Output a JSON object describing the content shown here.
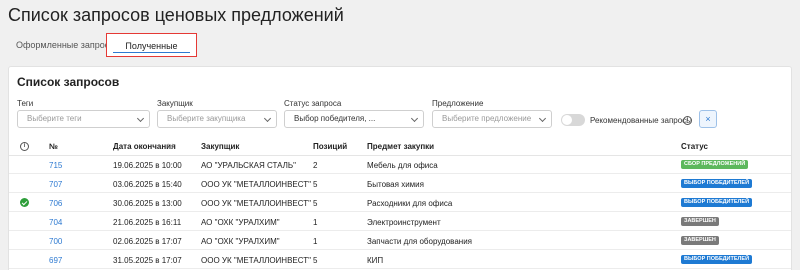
{
  "page": {
    "title": "Список запросов ценовых предложений"
  },
  "tabs": [
    {
      "label": "Оформленные запросы"
    },
    {
      "label": "Полученные запросы"
    }
  ],
  "card": {
    "title": "Список запросов"
  },
  "filters": {
    "tags": {
      "label": "Теги",
      "placeholder": "Выберите теги"
    },
    "buyer": {
      "label": "Закупщик",
      "placeholder": "Выберите закупщика"
    },
    "status": {
      "label": "Статус запроса",
      "value": "Выбор победителя, ..."
    },
    "offer": {
      "label": "Предложение",
      "placeholder": "Выберите предложение"
    },
    "recommended_label": "Рекомендованные запросы",
    "clear_symbol": "×"
  },
  "table": {
    "columns": [
      "№",
      "Дата окончания",
      "Закупщик",
      "Позиций",
      "Предмет закупки",
      "Статус"
    ],
    "rows": [
      {
        "num": "715",
        "date": "19.06.2025 в 10:00",
        "buyer": "АО \"УРАЛЬСКАЯ СТАЛЬ\"",
        "positions": "2",
        "subject": "Мебель для офиса",
        "status": "Сбор предложений",
        "status_color": "#5cb85c",
        "checked": false
      },
      {
        "num": "707",
        "date": "03.06.2025 в 15:40",
        "buyer": "ООО УК \"МЕТАЛЛОИНВЕСТ\"",
        "positions": "5",
        "subject": "Бытовая химия",
        "status": "Выбор победителей",
        "status_color": "#1e7ad3",
        "checked": false
      },
      {
        "num": "706",
        "date": "30.06.2025 в 13:00",
        "buyer": "ООО УК \"МЕТАЛЛОИНВЕСТ\"",
        "positions": "5",
        "subject": "Расходники для офиса",
        "status": "Выбор победителей",
        "status_color": "#1e7ad3",
        "checked": true
      },
      {
        "num": "704",
        "date": "21.06.2025 в 16:11",
        "buyer": "АО \"ОХК \"УРАЛХИМ\"",
        "positions": "1",
        "subject": "Электроинструмент",
        "status": "Завершен",
        "status_color": "#7a7a7a",
        "checked": false
      },
      {
        "num": "700",
        "date": "02.06.2025 в 17:07",
        "buyer": "АО \"ОХК \"УРАЛХИМ\"",
        "positions": "1",
        "subject": "Запчасти для оборудования",
        "status": "Завершен",
        "status_color": "#7a7a7a",
        "checked": false
      },
      {
        "num": "697",
        "date": "31.05.2025 в 17:07",
        "buyer": "ООО УК \"МЕТАЛЛОИНВЕСТ\"",
        "positions": "5",
        "subject": "КИП",
        "status": "Выбор победителей",
        "status_color": "#1e7ad3",
        "checked": false
      }
    ]
  }
}
